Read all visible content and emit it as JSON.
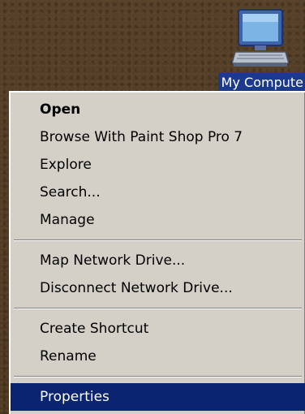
{
  "desktop": {
    "icon": {
      "name": "computer-icon",
      "label": "My Compute"
    }
  },
  "context_menu": {
    "groups": [
      [
        {
          "label": "Open",
          "bold": true
        },
        {
          "label": "Browse With Paint Shop Pro 7"
        },
        {
          "label": "Explore"
        },
        {
          "label": "Search..."
        },
        {
          "label": "Manage"
        }
      ],
      [
        {
          "label": "Map Network Drive..."
        },
        {
          "label": "Disconnect Network Drive..."
        }
      ],
      [
        {
          "label": "Create Shortcut"
        },
        {
          "label": "Rename"
        }
      ],
      [
        {
          "label": "Properties",
          "selected": true
        }
      ]
    ]
  },
  "colors": {
    "menu_background": "#d4d0c8",
    "selection": "#0a2470",
    "label_highlight": "#1b3a8c"
  }
}
